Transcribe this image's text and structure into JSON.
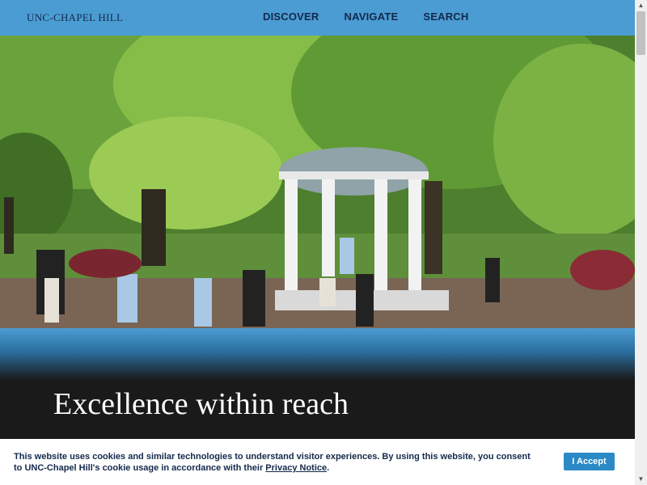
{
  "header": {
    "logo": "UNC-CHAPEL HILL",
    "nav": [
      "DISCOVER",
      "NAVIGATE",
      "SEARCH"
    ]
  },
  "hero": {
    "headline": "Excellence within reach"
  },
  "cookie": {
    "text_before": "This website uses cookies and similar technologies to understand visitor experiences. By using this website, you consent to UNC-Chapel Hill's cookie usage in accordance with their ",
    "link": "Privacy Notice",
    "text_after": ".",
    "accept_label": "I Accept"
  },
  "colors": {
    "carolina_blue": "#4b9cd3",
    "navy": "#13294b"
  }
}
